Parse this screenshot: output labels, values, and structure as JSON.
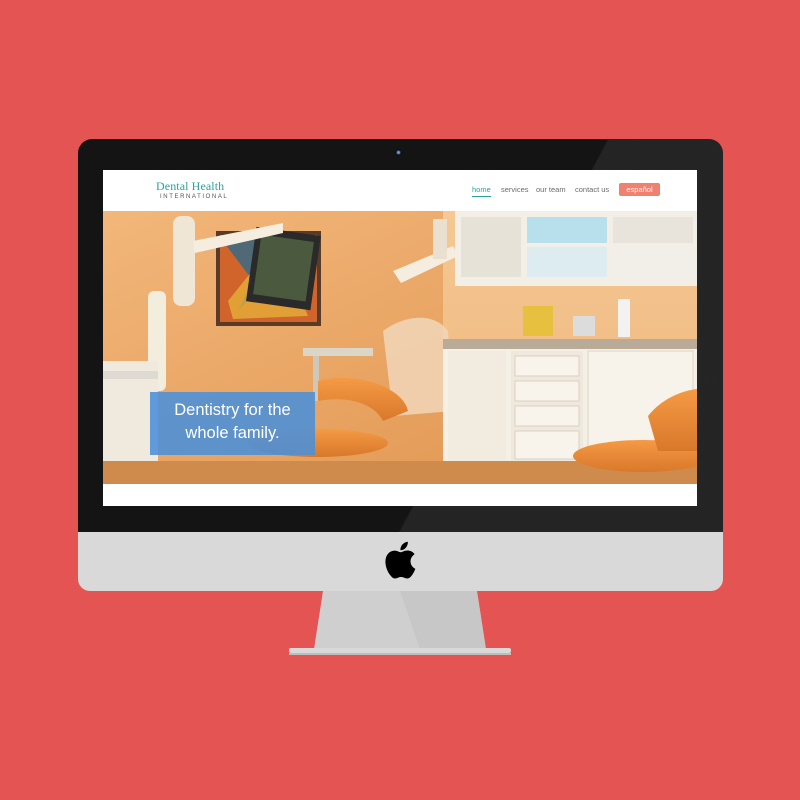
{
  "colors": {
    "background": "#e35452",
    "brand_teal": "#2aa39a",
    "lang_button": "#f08070",
    "tagline_box": "#4a90d9",
    "bezel": "#141414",
    "chin": "#d9d9d9"
  },
  "site": {
    "logo": {
      "name": "Dental Health",
      "tagline": "INTERNATIONAL"
    },
    "nav": {
      "items": [
        {
          "label": "home",
          "active": true
        },
        {
          "label": "services",
          "active": false
        },
        {
          "label": "our team",
          "active": false
        },
        {
          "label": "contact us",
          "active": false
        }
      ],
      "language_button": "español"
    },
    "hero": {
      "tagline_line1": "Dentistry for the",
      "tagline_line2": "whole family."
    }
  },
  "device": {
    "brand_icon": "apple-logo-icon"
  }
}
